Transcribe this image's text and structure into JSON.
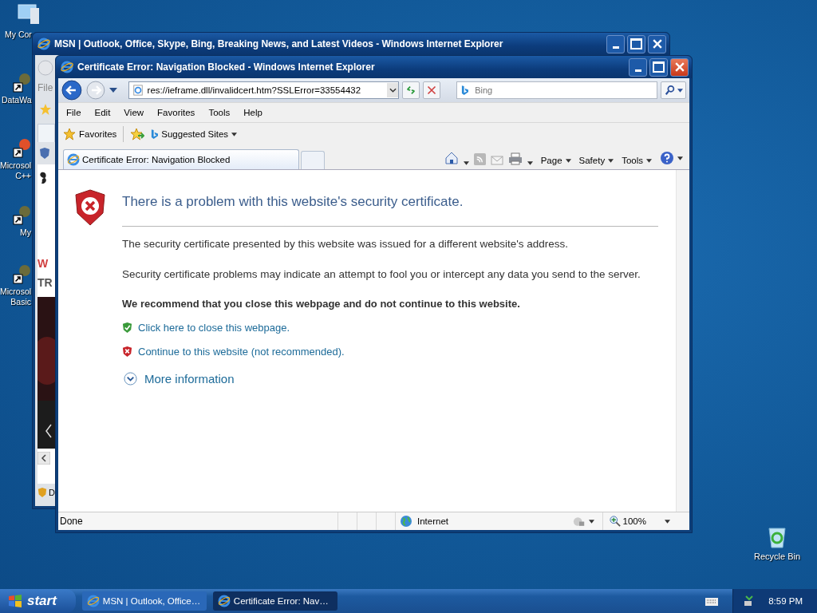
{
  "desktop_icons": [
    {
      "label": "My Cor"
    },
    {
      "label": "DataWa"
    },
    {
      "label": "Microsol C++"
    },
    {
      "label": "My"
    },
    {
      "label": "Microsol Basic"
    },
    {
      "label": "Recycle Bin"
    }
  ],
  "back_window": {
    "title": "MSN | Outlook, Office, Skype, Bing, Breaking News, and Latest Videos - Windows Internet Explorer",
    "menu_item": "File",
    "fragments": [
      "W",
      "TR"
    ],
    "status": "D"
  },
  "window": {
    "title": "Certificate Error: Navigation Blocked - Windows Internet Explorer",
    "address": "res://ieframe.dll/invalidcert.htm?SSLError=33554432",
    "search": {
      "placeholder": "Bing"
    },
    "menu": [
      "File",
      "Edit",
      "View",
      "Favorites",
      "Tools",
      "Help"
    ],
    "favorites_bar": {
      "favorites": "Favorites",
      "suggested": "Suggested Sites"
    },
    "tabs": [
      {
        "label": "Certificate Error: Navigation Blocked",
        "selected": true
      }
    ],
    "command_bar": [
      "Page",
      "Safety",
      "Tools"
    ],
    "content": {
      "heading": "There is a problem with this website's security certificate.",
      "paragraphs": [
        "The security certificate presented by this website was issued for a different website's address.",
        "Security certificate problems may indicate an attempt to fool you or intercept any data you send to the server."
      ],
      "recommendation": "We recommend that you close this webpage and do not continue to this website.",
      "links": [
        {
          "kind": "close",
          "text": "Click here to close this webpage."
        },
        {
          "kind": "continue",
          "text": "Continue to this website (not recommended)."
        }
      ],
      "more_info": "More information"
    },
    "status_bar": {
      "status": "Done",
      "zone": "Internet",
      "zoom": "100%"
    }
  },
  "taskbar": {
    "start": "start",
    "buttons": [
      {
        "label": "MSN | Outlook, Office…",
        "selected": false
      },
      {
        "label": "Certificate Error: Nav…",
        "selected": true
      }
    ],
    "clock": "8:59 PM"
  }
}
